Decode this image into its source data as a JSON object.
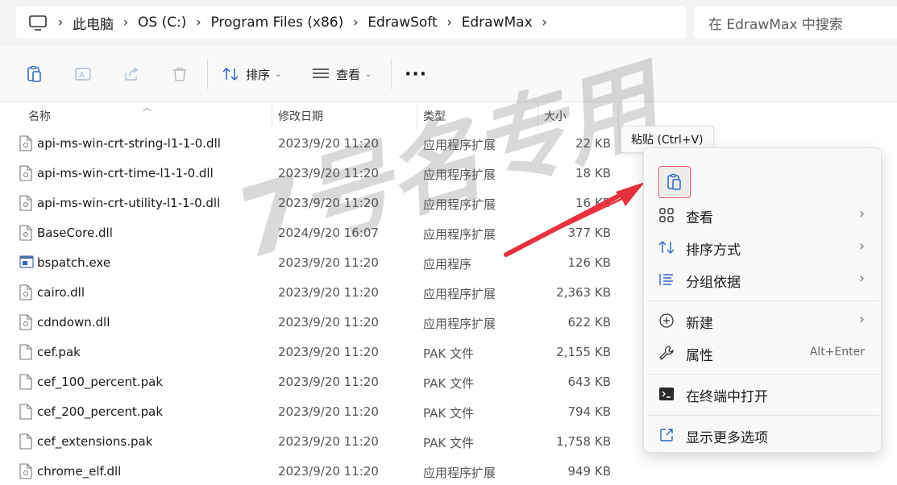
{
  "breadcrumb": [
    "此电脑",
    "OS (C:)",
    "Program Files (x86)",
    "EdrawSoft",
    "EdrawMax"
  ],
  "search": {
    "placeholder": "在 EdrawMax 中搜索"
  },
  "toolbar": {
    "sort_label": "排序",
    "view_label": "查看",
    "more_label": "···"
  },
  "columns": {
    "name": "名称",
    "date": "修改日期",
    "type": "类型",
    "size": "大小"
  },
  "files": [
    {
      "name": "api-ms-win-crt-string-l1-1-0.dll",
      "date": "2023/9/20 11:20",
      "type": "应用程序扩展",
      "size": "22 KB",
      "kind": "dll"
    },
    {
      "name": "api-ms-win-crt-time-l1-1-0.dll",
      "date": "2023/9/20 11:20",
      "type": "应用程序扩展",
      "size": "18 KB",
      "kind": "dll"
    },
    {
      "name": "api-ms-win-crt-utility-l1-1-0.dll",
      "date": "2023/9/20 11:20",
      "type": "应用程序扩展",
      "size": "16 KB",
      "kind": "dll"
    },
    {
      "name": "BaseCore.dll",
      "date": "2024/9/20 16:07",
      "type": "应用程序扩展",
      "size": "377 KB",
      "kind": "dll"
    },
    {
      "name": "bspatch.exe",
      "date": "2023/9/20 11:20",
      "type": "应用程序",
      "size": "126 KB",
      "kind": "exe"
    },
    {
      "name": "cairo.dll",
      "date": "2023/9/20 11:20",
      "type": "应用程序扩展",
      "size": "2,363 KB",
      "kind": "dll"
    },
    {
      "name": "cdndown.dll",
      "date": "2023/9/20 11:20",
      "type": "应用程序扩展",
      "size": "622 KB",
      "kind": "dll"
    },
    {
      "name": "cef.pak",
      "date": "2023/9/20 11:20",
      "type": "PAK 文件",
      "size": "2,155 KB",
      "kind": "file"
    },
    {
      "name": "cef_100_percent.pak",
      "date": "2023/9/20 11:20",
      "type": "PAK 文件",
      "size": "643 KB",
      "kind": "file"
    },
    {
      "name": "cef_200_percent.pak",
      "date": "2023/9/20 11:20",
      "type": "PAK 文件",
      "size": "794 KB",
      "kind": "file"
    },
    {
      "name": "cef_extensions.pak",
      "date": "2023/9/20 11:20",
      "type": "PAK 文件",
      "size": "1,758 KB",
      "kind": "file"
    },
    {
      "name": "chrome_elf.dll",
      "date": "2023/9/20 11:20",
      "type": "应用程序扩展",
      "size": "949 KB",
      "kind": "dll"
    }
  ],
  "tooltip": "粘贴 (Ctrl+V)",
  "context_menu": {
    "view": "查看",
    "sort_by": "排序方式",
    "group_by": "分组依据",
    "new": "新建",
    "properties": "属性",
    "properties_shortcut": "Alt+Enter",
    "open_terminal": "在终端中打开",
    "more_options": "显示更多选项"
  },
  "watermark": "7号名专用",
  "colors": {
    "arrow": "#e8323f",
    "highlight_border": "#e05060"
  }
}
